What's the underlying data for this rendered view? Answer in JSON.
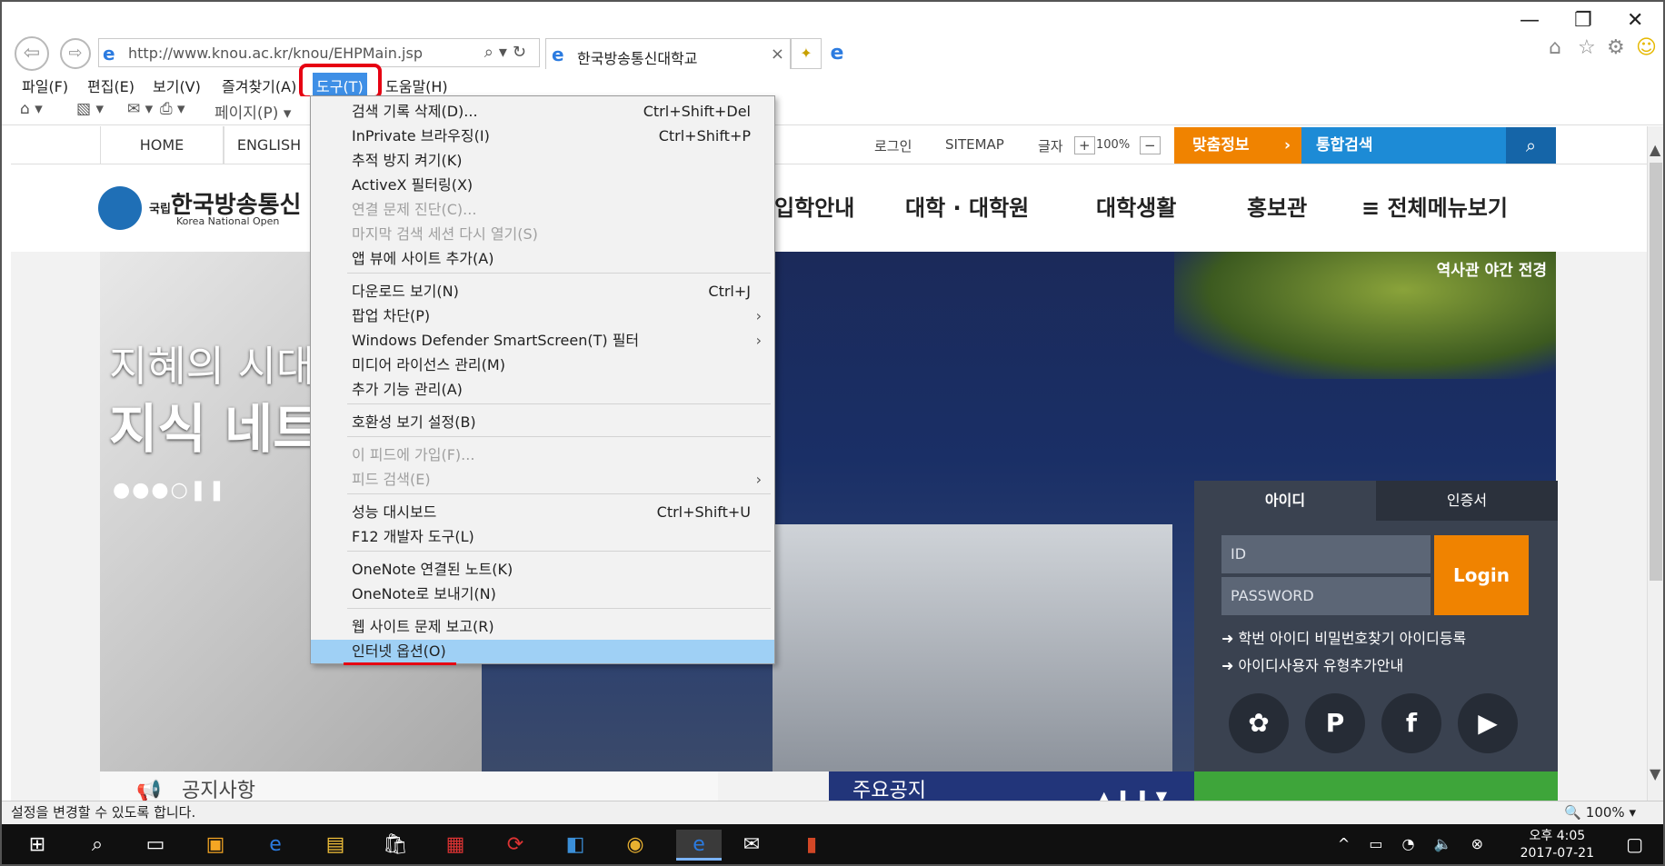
{
  "browser": {
    "url_host": "http://www.knou.ac.kr",
    "url_path": "/knou/EHPMain.jsp",
    "tab_title": "한국방송통신대학교",
    "tab_close": "×"
  },
  "menubar": [
    {
      "label": "파일(F)"
    },
    {
      "label": "편집(E)"
    },
    {
      "label": "보기(V)"
    },
    {
      "label": "즐겨찾기(A)"
    },
    {
      "label": "도구(T)"
    },
    {
      "label": "도움말(H)"
    }
  ],
  "commandbar": {
    "page_label": "페이지(P) ▾"
  },
  "tools_menu": {
    "items": [
      {
        "label": "검색 기록 삭제(D)...",
        "shortcut": "Ctrl+Shift+Del",
        "disabled": false
      },
      {
        "label": "InPrivate 브라우징(I)",
        "shortcut": "Ctrl+Shift+P",
        "disabled": false
      },
      {
        "label": "추적 방지 켜기(K)",
        "shortcut": "",
        "disabled": false
      },
      {
        "label": "ActiveX 필터링(X)",
        "shortcut": "",
        "disabled": false
      },
      {
        "label": "연결 문제 진단(C)...",
        "shortcut": "",
        "disabled": true
      },
      {
        "label": "마지막 검색 세션 다시 열기(S)",
        "shortcut": "",
        "disabled": true
      },
      {
        "label": "앱 뷰에 사이트 추가(A)",
        "shortcut": "",
        "disabled": false
      },
      {
        "label": "다운로드 보기(N)",
        "shortcut": "Ctrl+J",
        "disabled": false
      },
      {
        "label": "팝업 차단(P)",
        "shortcut": "",
        "submenu": true,
        "disabled": false
      },
      {
        "label": "Windows Defender SmartScreen(T) 필터",
        "shortcut": "",
        "submenu": true,
        "disabled": false
      },
      {
        "label": "미디어 라이선스 관리(M)",
        "shortcut": "",
        "disabled": false
      },
      {
        "label": "추가 기능 관리(A)",
        "shortcut": "",
        "disabled": false
      },
      {
        "label": "호환성 보기 설정(B)",
        "shortcut": "",
        "disabled": false
      },
      {
        "label": "이 피드에 가입(F)...",
        "shortcut": "",
        "disabled": true
      },
      {
        "label": "피드 검색(E)",
        "shortcut": "",
        "submenu": true,
        "disabled": true
      },
      {
        "label": "성능 대시보드",
        "shortcut": "Ctrl+Shift+U",
        "disabled": false
      },
      {
        "label": "F12 개발자 도구(L)",
        "shortcut": "",
        "disabled": false
      },
      {
        "label": "OneNote 연결된 노트(K)",
        "shortcut": "",
        "disabled": false
      },
      {
        "label": "OneNote로 보내기(N)",
        "shortcut": "",
        "disabled": false
      },
      {
        "label": "웹 사이트 문제 보고(R)",
        "shortcut": "",
        "disabled": false
      },
      {
        "label": "인터넷 옵션(O)",
        "shortcut": "",
        "disabled": false,
        "highlighted": true
      }
    ]
  },
  "site": {
    "top_tabs": [
      "HOME",
      "ENGLISH"
    ],
    "util": {
      "login": "로그인",
      "sitemap": "SITEMAP",
      "font_label": "글자",
      "zoom": "100%"
    },
    "fit_info": "맞춤정보",
    "search_label": "통합검색",
    "logo_text": "한국방송통신",
    "logo_sub": "Korea National Open",
    "logo_prefix": "국립",
    "gnb": [
      "입학안내",
      "대학 · 대학원",
      "대학생활",
      "홍보관",
      "전체메뉴보기"
    ],
    "hero": {
      "caption": "역사관 야간 전경",
      "line1": "지혜의 시대",
      "line2": "지식 네트"
    },
    "login": {
      "tab_id": "아이디",
      "tab_cert": "인증서",
      "id_placeholder": "ID",
      "pw_placeholder": "PASSWORD",
      "login_btn": "Login",
      "link1": "학번  아이디  비밀번호찾기  아이디등록",
      "link2": "아이디사용자 유형추가안내"
    },
    "notice": "공지사항",
    "main_notice": "주요공지"
  },
  "statusbar": {
    "message": "설정을 변경할 수 있도록 합니다.",
    "zoom": "🔍 100%  ▾"
  },
  "taskbar": {
    "time": "오후 4:05",
    "date": "2017-07-21"
  }
}
